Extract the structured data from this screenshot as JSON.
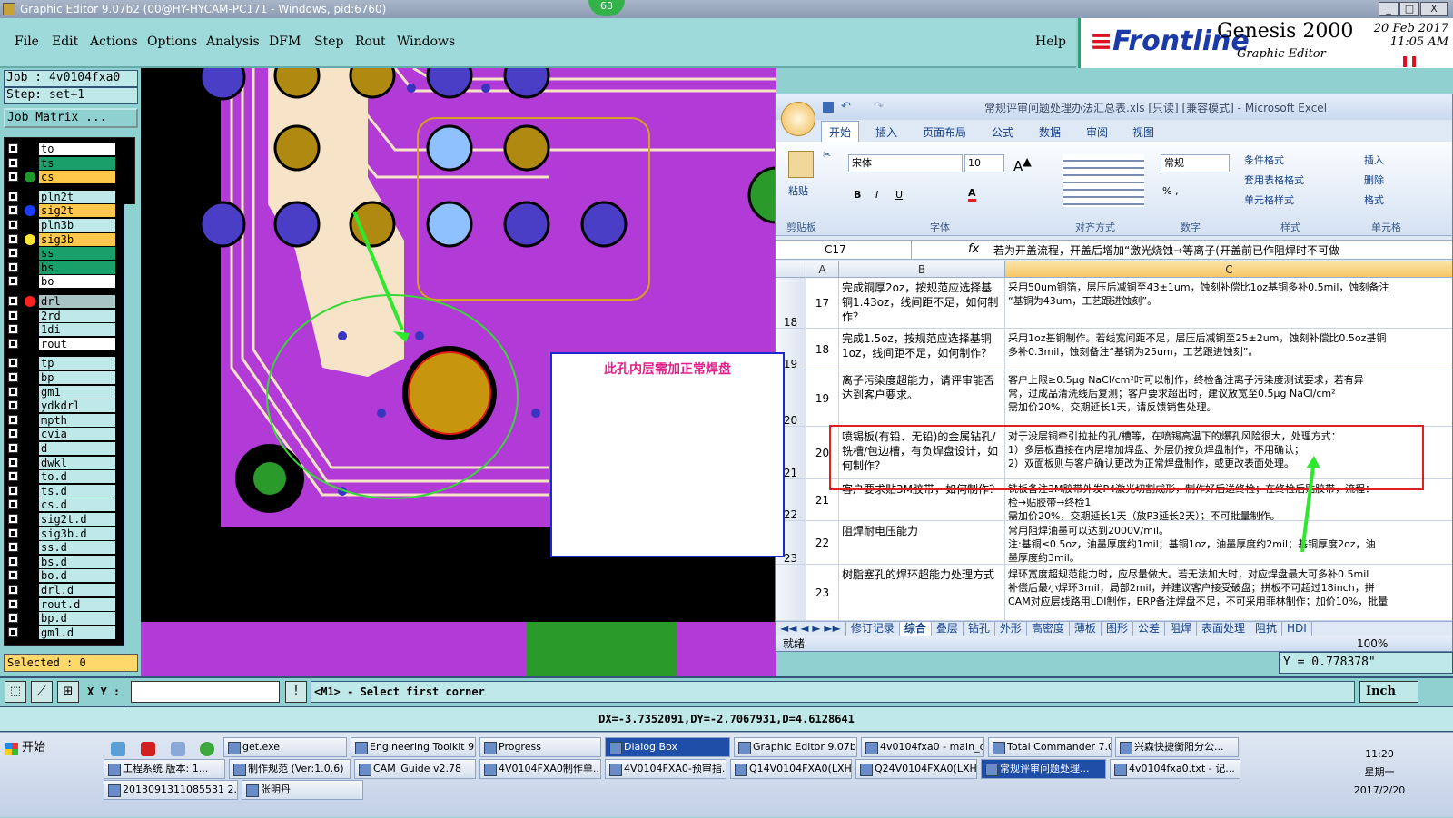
{
  "window": {
    "title": "Graphic Editor 9.07b2 (00@HY-HYCAM-PC171 - Windows, pid:6760)",
    "badge": "68"
  },
  "menu": [
    "File",
    "Edit",
    "Actions",
    "Options",
    "Analysis",
    "DFM",
    "Step",
    "Rout",
    "Windows"
  ],
  "help_label": "Help",
  "brand": {
    "logo": "Frontline",
    "product": "Genesis 2000",
    "subtitle": "Graphic Editor",
    "date": "20 Feb 2017",
    "time": "11:05 AM"
  },
  "job": {
    "job_label": "Job : 4v0104fxa0",
    "step_label": "Step: set+1",
    "matrix_button": "Job Matrix ..."
  },
  "layers": [
    {
      "name": "to",
      "color": "#ffffff",
      "dot": ""
    },
    {
      "name": "ts",
      "color": "#19a06a",
      "dot": ""
    },
    {
      "name": "cs",
      "color": "#ffc84a",
      "dot": "#1e9a2a"
    },
    {
      "name": "pln2t",
      "color": "#bfe8e8",
      "dot": ""
    },
    {
      "name": "sig2t",
      "color": "#ffc84a",
      "dot": "#1a3cff"
    },
    {
      "name": "pln3b",
      "color": "#bfe8e8",
      "dot": ""
    },
    {
      "name": "sig3b",
      "color": "#ffc84a",
      "dot": "#ffe630"
    },
    {
      "name": "ss",
      "color": "#19a06a",
      "dot": ""
    },
    {
      "name": "bs",
      "color": "#19a06a",
      "dot": ""
    },
    {
      "name": "bo",
      "color": "#ffffff",
      "dot": ""
    },
    {
      "name": "drl",
      "color": "#a8c4c4",
      "dot": "#ff2020"
    },
    {
      "name": "2rd",
      "color": "#bfe8e8",
      "dot": ""
    },
    {
      "name": "1di",
      "color": "#bfe8e8",
      "dot": ""
    },
    {
      "name": "rout",
      "color": "#ffffff",
      "dot": ""
    },
    {
      "name": "tp",
      "color": "#bfe8e8",
      "dot": ""
    },
    {
      "name": "bp",
      "color": "#bfe8e8",
      "dot": ""
    },
    {
      "name": "gm1",
      "color": "#bfe8e8",
      "dot": ""
    },
    {
      "name": "ydkdrl",
      "color": "#bfe8e8",
      "dot": ""
    },
    {
      "name": "mpth",
      "color": "#bfe8e8",
      "dot": ""
    },
    {
      "name": "cvia",
      "color": "#bfe8e8",
      "dot": ""
    },
    {
      "name": "d",
      "color": "#bfe8e8",
      "dot": ""
    },
    {
      "name": "dwkl",
      "color": "#bfe8e8",
      "dot": ""
    },
    {
      "name": "to.d",
      "color": "#bfe8e8",
      "dot": ""
    },
    {
      "name": "ts.d",
      "color": "#bfe8e8",
      "dot": ""
    },
    {
      "name": "cs.d",
      "color": "#bfe8e8",
      "dot": ""
    },
    {
      "name": "sig2t.d",
      "color": "#bfe8e8",
      "dot": ""
    },
    {
      "name": "sig3b.d",
      "color": "#bfe8e8",
      "dot": ""
    },
    {
      "name": "ss.d",
      "color": "#bfe8e8",
      "dot": ""
    },
    {
      "name": "bs.d",
      "color": "#bfe8e8",
      "dot": ""
    },
    {
      "name": "bo.d",
      "color": "#bfe8e8",
      "dot": ""
    },
    {
      "name": "drl.d",
      "color": "#bfe8e8",
      "dot": ""
    },
    {
      "name": "rout.d",
      "color": "#bfe8e8",
      "dot": ""
    },
    {
      "name": "bp.d",
      "color": "#bfe8e8",
      "dot": ""
    },
    {
      "name": "gm1.d",
      "color": "#bfe8e8",
      "dot": ""
    }
  ],
  "selected_label": "Selected : 0",
  "dialog": {
    "message": "此孔内层需加正常焊盘"
  },
  "excel": {
    "title": "常规评审问题处理办法汇总表.xls  [只读]  [兼容模式] - Microsoft Excel",
    "tabs": [
      "开始",
      "插入",
      "页面布局",
      "公式",
      "数据",
      "审阅",
      "视图"
    ],
    "clipboard": {
      "paste": "粘贴",
      "group": "剪贴板"
    },
    "font": {
      "name": "宋体",
      "size": "10",
      "group": "字体",
      "bold": "B",
      "italic": "I",
      "underline": "U"
    },
    "align_group": "对齐方式",
    "number": {
      "format": "常规",
      "group": "数字"
    },
    "styles": {
      "conditional": "条件格式",
      "table": "套用表格格式",
      "cell": "单元格样式",
      "group": "样式"
    },
    "cells": {
      "insert": "插入",
      "delete": "删除",
      "format": "格式",
      "group": "单元格"
    },
    "name_box": "C17",
    "fx": "fx",
    "formula": "若为开盖流程，开盖后增加“激光烧蚀→等离子(开盖前已作阻焊时不可做",
    "columns": [
      "A",
      "B",
      "C"
    ],
    "rows": [
      {
        "rn": "18",
        "a": "17",
        "b": "完成铜厚2oz，按规范应选择基铜1.43oz，线间距不足，如何制作？",
        "c": "采用50um铜箔，层压后减铜至43±1um，蚀刻补偿比1oz基铜多补0.5mil，蚀刻备注\n“基铜为43um，工艺跟进蚀刻”。"
      },
      {
        "rn": "19",
        "a": "18",
        "b": "完成1.5oz，按规范应选择基铜1oz，线间距不足，如何制作？",
        "c": "采用1oz基铜制作。若线宽间距不足，层压后减铜至25±2um，蚀刻补偿比0.5oz基铜\n多补0.3mil，蚀刻备注“基铜为25um，工艺跟进蚀刻”。"
      },
      {
        "rn": "20",
        "a": "19",
        "b": "离子污染度超能力，请评审能否达到客户要求。",
        "c": "客户上限≥0.5μg NaCl/cm²时可以制作，终检备注离子污染度测试要求，若有异\n常，过成品清洗线后复测；客户要求超出时，建议放宽至0.5μg NaCl/cm²\n需加价20%，交期延长1天，请反馈销售处理。"
      },
      {
        "rn": "21",
        "a": "20",
        "b": "喷锡板(有铅、无铅)的金属钻孔/铣槽/包边槽，有负焊盘设计，如何制作？",
        "c": "对于没层铜牵引拉扯的孔/槽等，在喷锡高温下的爆孔风险很大，处理方式：\n1）多层板直接在内层增加焊盘、外层仍按负焊盘制作，不用确认；\n2）双面板则与客户确认更改为正常焊盘制作，或更改表面处理。"
      },
      {
        "rn": "22",
        "a": "21",
        "b": "客户要求贴3M胶带，如何制作？",
        "c": "铣板备注3M胶带外发P4激光切割成形，制作好后送终检；在终检后贴胶带，流程：\n检→贴胶带→终检1\n需加价20%，交期延长1天（放P3延长2天）；不可批量制作。"
      },
      {
        "rn": "23",
        "a": "22",
        "b": "阻焊耐电压能力",
        "c": "常用阻焊油墨可以达到2000V/mil。\n注:基铜≤0.5oz，油墨厚度约1mil；基铜1oz，油墨厚度约2mil；基铜厚度2oz，油\n墨厚度约3mil。"
      },
      {
        "rn": "",
        "a": "23",
        "b": "树脂塞孔的焊环超能力处理方式",
        "c": "焊环宽度超规范能力时，应尽量做大。若无法加大时，对应焊盘最大可多补0.5mil\n补偿后最小焊环3mil，局部2mil，并建议客户接受破盘；拼板不可超过18inch，拼\nCAM对应层线路用LDI制作，ERP备注焊盘不足，不可采用菲林制作；加价10%，批量"
      }
    ],
    "sheets": [
      "修订记录",
      "综合",
      "叠层",
      "钻孔",
      "外形",
      "高密度",
      "薄板",
      "图形",
      "公差",
      "阻焊",
      "表面处理",
      "阻抗",
      "HDI"
    ],
    "status": "就绪",
    "zoom": "100%"
  },
  "coord_readout": "Y = 0.778378\"",
  "cmd": {
    "xy_label": "X Y :",
    "prompt": "<M1> - Select first corner",
    "unit": "Inch"
  },
  "measure": "DX=-3.7352091,DY=-2.7067931,D=4.6128641",
  "taskbar": {
    "start": "开始",
    "row1": [
      "get.exe",
      "Engineering Toolkit 9....",
      "Progress",
      "Dialog Box",
      "Graphic Editor 9.07b2...",
      "4v0104fxa0 - main_qa",
      "Total Commander 7.0...",
      "兴森快捷衡阳分公..."
    ],
    "row2": [
      "工程系统  版本: 1...",
      "制作规范 (Ver:1.0.6)",
      "CAM_Guide v2.78",
      "4V0104FXA0制作单....",
      "4V0104FXA0-预审指...",
      "Q14V0104FXA0(LXH...",
      "Q24V0104FXA0(LXH...",
      "常规评审问题处理...",
      "4v0104fxa0.txt - 记..."
    ],
    "row3": [
      "2013091311085531 2.rtf...",
      "张明丹"
    ],
    "clock": {
      "time": "11:20",
      "day": "星期一",
      "date": "2017/2/20"
    }
  }
}
